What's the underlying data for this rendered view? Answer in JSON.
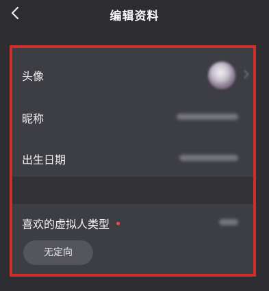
{
  "header": {
    "back_icon": "chevron-left-icon",
    "title": "编辑资料"
  },
  "profile": {
    "avatar_label": "头像",
    "nickname_label": "昵称",
    "birthday_label": "出生日期"
  },
  "preference": {
    "label": "喜欢的虚拟人类型",
    "required_marker_color": "#e05050",
    "selected_option": "无定向"
  },
  "colors": {
    "background": "#2c2c31",
    "panel": "#3d3d44",
    "highlight_border": "#cf2f2b"
  }
}
